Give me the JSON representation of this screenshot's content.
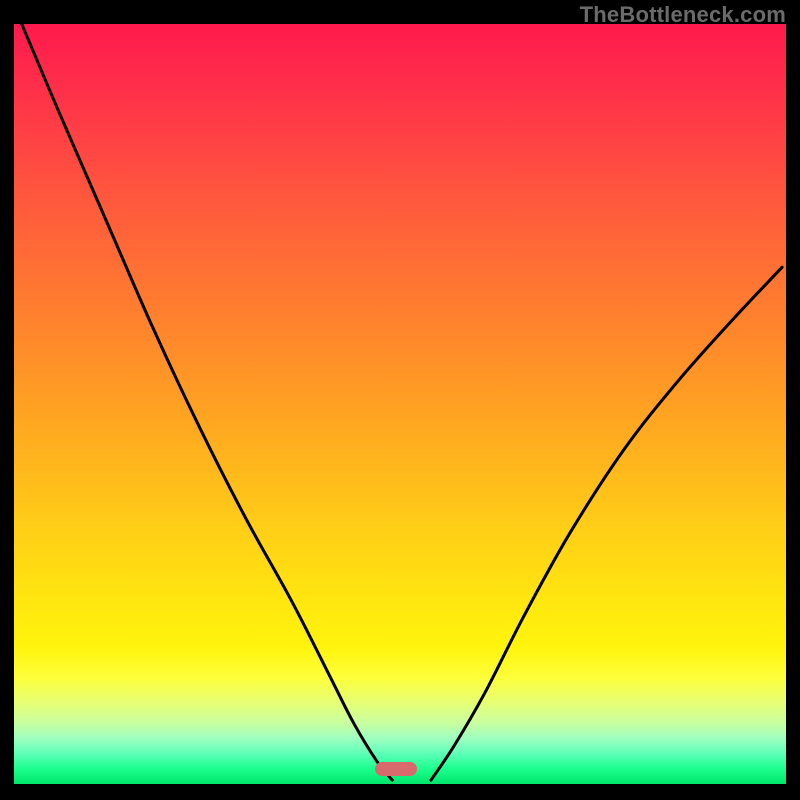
{
  "watermark": "TheBottleneck.com",
  "marker": {
    "x_pct": 49.5,
    "y_pct": 98.0
  },
  "chart_data": {
    "type": "line",
    "title": "",
    "xlabel": "",
    "ylabel": "",
    "xlim": [
      0,
      100
    ],
    "ylim": [
      0,
      100
    ],
    "series": [
      {
        "name": "left-branch",
        "x": [
          1,
          6,
          12,
          18,
          24,
          30,
          36,
          41,
          44,
          47,
          49
        ],
        "y": [
          100,
          88,
          74,
          60,
          47,
          35,
          24,
          14,
          8,
          3,
          0.5
        ]
      },
      {
        "name": "right-branch",
        "x": [
          54,
          57,
          61,
          66,
          72,
          79,
          86,
          93,
          99.5
        ],
        "y": [
          0.5,
          5,
          12,
          22,
          33,
          44,
          53,
          61,
          68
        ]
      }
    ],
    "marker_points": [
      {
        "name": "valley-marker",
        "x": 50,
        "y": 1.5
      }
    ],
    "background_gradient": {
      "direction": "vertical",
      "stops": [
        {
          "pos": 0.0,
          "color": "#ff1a4d"
        },
        {
          "pos": 0.35,
          "color": "#ff7a30"
        },
        {
          "pos": 0.7,
          "color": "#ffd814"
        },
        {
          "pos": 0.9,
          "color": "#e8ff78"
        },
        {
          "pos": 1.0,
          "color": "#00e66a"
        }
      ]
    }
  }
}
